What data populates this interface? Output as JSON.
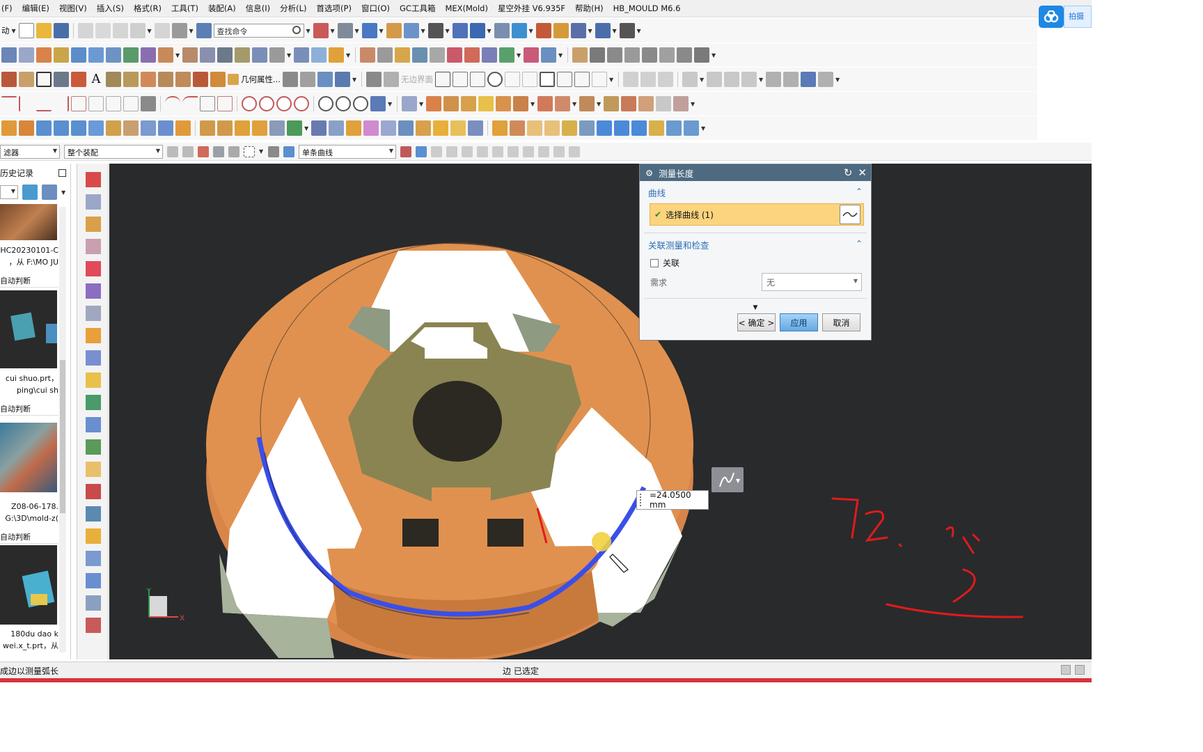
{
  "menu": [
    "(F)",
    "编辑(E)",
    "视图(V)",
    "插入(S)",
    "格式(R)",
    "工具(T)",
    "装配(A)",
    "信息(I)",
    "分析(L)",
    "首选项(P)",
    "窗口(O)",
    "GC工具箱",
    "MEX(Mold)",
    "星空外挂 V6.935F",
    "帮助(H)",
    "HB_MOULD M6.6"
  ],
  "cloud": {
    "tab_label": "拍摄"
  },
  "toolbar": {
    "start_label": "动",
    "search_placeholder": "查找命令",
    "geometry_props_label": "几何属性...",
    "hidden_label": "无边界面"
  },
  "selection_bar": {
    "type_filter": "滤器",
    "scope": "整个装配",
    "curve_rule": "单条曲线"
  },
  "history": {
    "title": "历史记录",
    "items": [
      {
        "cap1": "HC20230101-C",
        "cap2": "，从 F:\\MO JU"
      },
      {
        "section": "自动判断",
        "cap1": "cui shuo.prt，",
        "cap2": "ping\\cui sh"
      },
      {
        "section": "自动判断",
        "cap1": "Z08-06-178.",
        "cap2": "G:\\3D\\mold-z("
      },
      {
        "section": "自动判断",
        "cap1": "180du dao k",
        "cap2": "wei.x_t.prt，从"
      }
    ]
  },
  "dialog": {
    "title": "测量长度",
    "group1": "曲线",
    "select_curve": "选择曲线 (1)",
    "group2": "关联测量和检查",
    "assoc_label": "关联",
    "assoc_checked": false,
    "requirement_label": "需求",
    "requirement_value": "无",
    "ok": "< 确定 >",
    "apply": "应用",
    "cancel": "取消"
  },
  "readout": "=24.0500 mm",
  "annotation": {
    "handwritten": "72.34",
    "color": "#e01b1b"
  },
  "triad": {
    "y": "Y",
    "x": "X"
  },
  "status": {
    "left": "成边以测量弧长",
    "center": "边 已选定"
  },
  "colors": {
    "viewport_bg": "#292a2c",
    "orange_part": "#e0914f",
    "olive_part": "#8a8452",
    "sage_part": "#a7b39a",
    "highlight_blue": "#3a4fe8",
    "dialog_title": "#4d6a80",
    "apply_button": "#66a9e3"
  }
}
